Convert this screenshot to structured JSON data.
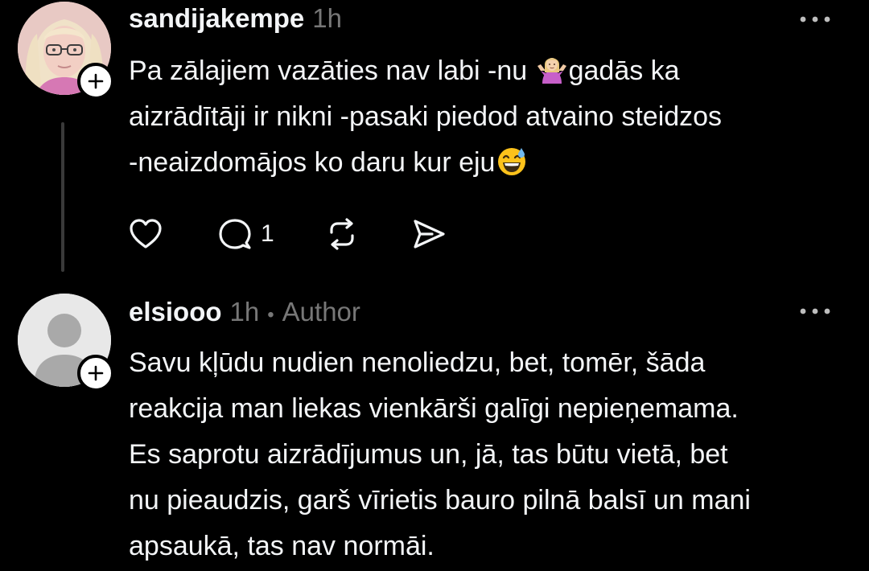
{
  "posts": [
    {
      "username": "sandijakempe",
      "time": "1h",
      "text_line1_a": "Pa zālajiem vazāties nav labi -nu ",
      "text_line1_b": "gadās ka",
      "text_line2": "aizrādītāji ir nikni -pasaki piedod atvaino steidzos",
      "text_line3": "-neaizdomājos ko daru kur eju",
      "emoji_1": "person-shrugging-emoji",
      "emoji_2": "grinning-face-with-sweat-emoji",
      "reply_count": "1"
    },
    {
      "username": "elsiooo",
      "time": "1h",
      "separator": "•",
      "author_label": "Author",
      "text_lines": [
        "Savu kļūdu nudien nenoliedzu, bet, tomēr, šāda",
        "reakcija man liekas vienkārši galīgi nepieņemama.",
        "Es saprotu aizrādījumus un, jā, tas būtu vietā, bet",
        "nu pieaudzis, garš vīrietis bauro pilnā balsī un mani",
        "apsaukā, tas nav normāi."
      ]
    }
  ],
  "icons": {
    "follow": "plus-icon",
    "more": "more-horizontal-icon",
    "like": "heart-icon",
    "reply": "comment-icon",
    "repost": "repost-icon",
    "share": "share-icon"
  },
  "colors": {
    "background": "#000000",
    "text": "#f3f5f7",
    "secondary": "#777777",
    "thread_line": "#3a3a3a"
  }
}
